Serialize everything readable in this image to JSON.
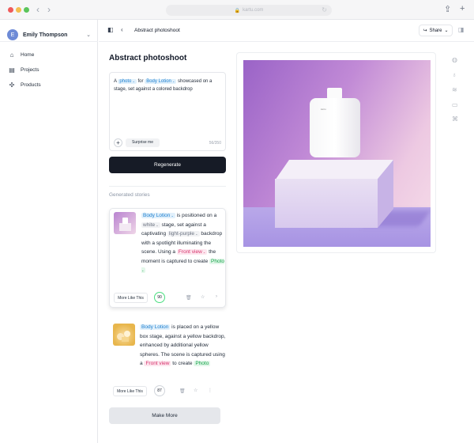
{
  "browser": {
    "url": "kartu.com"
  },
  "sidebar": {
    "user": {
      "initial": "E",
      "name": "Emily Thompson"
    },
    "items": [
      {
        "label": "Home",
        "icon": "home-icon"
      },
      {
        "label": "Projects",
        "icon": "document-icon"
      },
      {
        "label": "Products",
        "icon": "sparkle-icon"
      }
    ]
  },
  "header": {
    "title": "Abstract photoshoot",
    "share_label": "Share"
  },
  "editor": {
    "page_title": "Abstract photoshoot",
    "prompt": {
      "t0": "A",
      "photo": "photo",
      "t1": "for",
      "product": "Body Lotion",
      "t2": "showcased on a stage, set against a colored backdrop"
    },
    "surprise_label": "Surprise me",
    "char_count": "56/350",
    "regenerate_label": "Regenerate"
  },
  "stories": {
    "section_title": "Generated stories",
    "items": [
      {
        "product": "Body Lotion",
        "t1": "is positioned on a",
        "color1": "white",
        "t2": "stage, set against a captivating",
        "color2": "light-purple",
        "t3": "backdrop with a spotlight illuminating the scene. Using a",
        "view": "Front view",
        "t4": "the moment is captured to create",
        "output": "Photo",
        "more_label": "More Like This",
        "score": "90"
      },
      {
        "product": "Body Lotion",
        "t1": "is placed on a",
        "color1": "yellow",
        "t2": "box stage, against a",
        "color2": "yellow",
        "t3": "backdrop, enhanced by additional",
        "color3": "yellow",
        "t4": "spheres. The scene is captured using a",
        "view": "Front view",
        "t5": "to create",
        "output": "Photo",
        "more_label": "More Like This",
        "score": "87"
      }
    ],
    "make_more_label": "Make More"
  },
  "preview": {
    "bottle_label": "kartu"
  },
  "colors": {
    "primary_button": "#161b26",
    "score_high": "#4ade80",
    "tag_blue": "#1d7fcf",
    "tag_pink": "#d6336c",
    "tag_green": "#16a34a"
  }
}
